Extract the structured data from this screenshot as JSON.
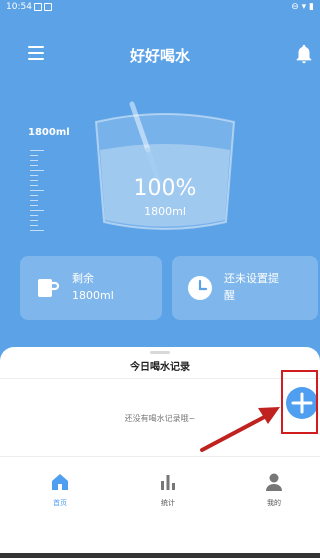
{
  "status_bar": {
    "time": "10:54"
  },
  "header": {
    "title": "好好喝水",
    "menu_icon": "hamburger-menu-icon",
    "bell_icon": "bell-icon"
  },
  "water": {
    "goal": "1800ml",
    "percent": "100%",
    "amount": "1800ml",
    "fill_fraction": 1.0
  },
  "cards": {
    "remaining": {
      "title": "剩余",
      "value": "1800ml",
      "icon": "cup-icon"
    },
    "reminder": {
      "line1": "还未设置提",
      "line2": "醒",
      "icon": "clock-icon"
    }
  },
  "records": {
    "title": "今日喝水记录",
    "empty_message": "还没有喝水记录哦~"
  },
  "nav": {
    "items": [
      {
        "label": "首页",
        "icon": "home-icon",
        "active": true
      },
      {
        "label": "统计",
        "icon": "bar-chart-icon",
        "active": false
      },
      {
        "label": "我的",
        "icon": "profile-icon",
        "active": false
      }
    ]
  },
  "colors": {
    "primary": "#5ba2e6",
    "accent": "#4f9ef0",
    "highlight": "#d11d1d",
    "white": "#ffffff"
  }
}
